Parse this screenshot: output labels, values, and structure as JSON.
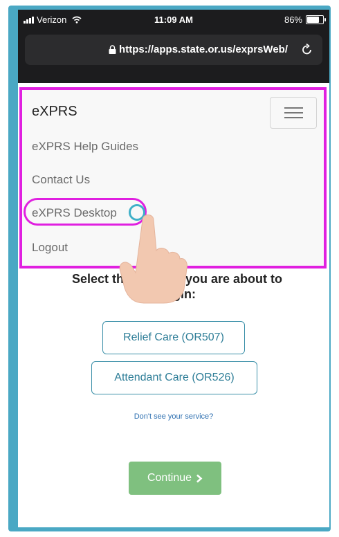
{
  "status_bar": {
    "carrier": "Verizon",
    "time": "11:09 AM",
    "battery_percent": "86%",
    "battery_level": 0.86
  },
  "browser": {
    "url": "https://apps.state.or.us/exprsWeb/"
  },
  "nav": {
    "brand": "eXPRS",
    "items": [
      {
        "label": "eXPRS Help Guides"
      },
      {
        "label": "Contact Us"
      },
      {
        "label": "eXPRS Desktop"
      },
      {
        "label": "Logout"
      }
    ]
  },
  "main": {
    "heading_line1": "Select the se",
    "heading_mid": "you are about to",
    "heading_line2": "begin:",
    "services": [
      {
        "label": "Relief Care (OR507)"
      },
      {
        "label": "Attendant Care (OR526)"
      }
    ],
    "help_link": "Don't see your service?",
    "continue_label": "Continue"
  },
  "colors": {
    "highlight": "#e020e0",
    "frame": "#4aa8c4",
    "accent": "#2d7d97",
    "continue": "#7fc07f"
  },
  "icons": [
    "signal-icon",
    "wifi-icon",
    "battery-icon",
    "lock-icon",
    "reload-icon",
    "hamburger-icon",
    "tap-hand-icon",
    "chevron-right-icon"
  ]
}
